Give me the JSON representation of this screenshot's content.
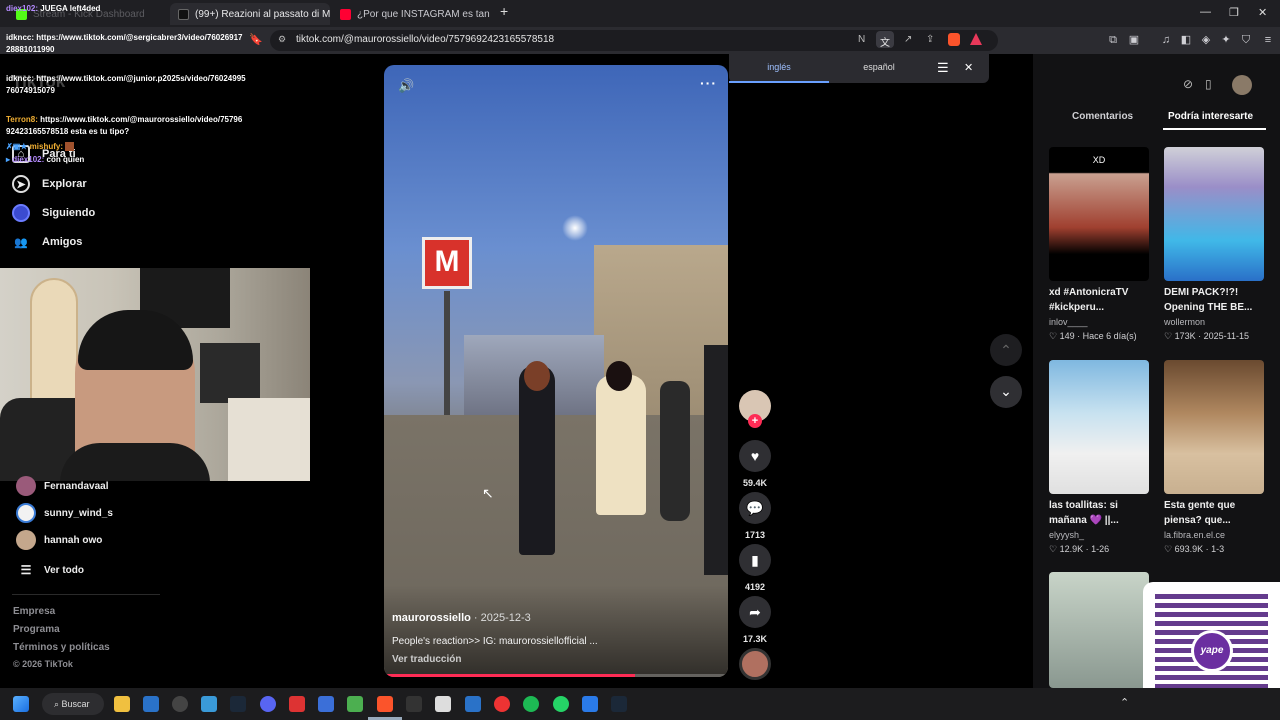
{
  "browser": {
    "tabs": [
      {
        "label": "Stream - Kick Dashboard"
      },
      {
        "label": "(99+) Reazioni al passato di M"
      },
      {
        "label": "¿Por que INSTAGRAM es tan RACISTA"
      }
    ],
    "url": "tiktok.com/@maurorossiello/video/7579692423165578518",
    "translate": {
      "source": "inglés",
      "target": "español"
    }
  },
  "chat": [
    {
      "user": "diex102:",
      "text": "JUEGA left4ded",
      "color": "#b58cff"
    },
    {
      "user": "idkncc:",
      "text": "https://www.tiktok.com/@sergicabrer3/video/7602691728881011990",
      "color": "#ffffff"
    },
    {
      "user": "idkncc:",
      "text": "https://www.tiktok.com/@junior.p2025s/video/7602499576074915079",
      "color": "#ffffff"
    },
    {
      "user": "Terron8:",
      "text": "https://www.tiktok.com/@maurorossiello/video/7579692423165578518 esta es tu tipo?",
      "color": "#f2b033"
    },
    {
      "user": "mishufy:",
      "text": "",
      "color": "#f2b033"
    },
    {
      "user": "diex102:",
      "text": "con quien",
      "color": "#b58cff"
    }
  ],
  "nav": {
    "items": [
      {
        "label": "Para ti",
        "icon": "home-icon"
      },
      {
        "label": "Explorar",
        "icon": "compass-icon"
      },
      {
        "label": "Siguiendo",
        "icon": "following-icon"
      },
      {
        "label": "Amigos",
        "icon": "friends-icon"
      }
    ],
    "following": [
      {
        "name": "Fernandavaal"
      },
      {
        "name": "sunny_wind_s"
      },
      {
        "name": "hannah owo"
      }
    ],
    "see_all": "Ver todo",
    "footer": [
      "Empresa",
      "Programa",
      "Términos y políticas",
      "© 2026 TikTok"
    ]
  },
  "video": {
    "author": "maurorossiello",
    "date": "· 2025-12-3",
    "caption": "People's reaction>> IG: maurorossiellofficial ...",
    "translate_link": "Ver traducción",
    "progress": 0.73,
    "metro_sign": "M"
  },
  "actions": {
    "likes": "59.4K",
    "comments": "1713",
    "saves": "4192",
    "shares": "17.3K"
  },
  "right_panel": {
    "tabs": [
      "Comentarios",
      "Podría interesarte"
    ],
    "cards": [
      {
        "title": "xd #AntonicraTV #kickperu...",
        "author": "inlov____",
        "likes": "149",
        "date": "· Hace 6 día(s)",
        "overlay": "XD"
      },
      {
        "title": "DEMI PACK?!?! Opening THE BE...",
        "author": "wollermon",
        "likes": "173K",
        "date": "· 2025-11-15",
        "overlay": ""
      },
      {
        "title": "las toallitas: si mañana 💜 ||...",
        "author": "elyyysh_",
        "likes": "12.9K",
        "date": "· 1-26",
        "overlay": ""
      },
      {
        "title": "Esta gente que piensa? que...",
        "author": "la.fibra.en.el.ce",
        "likes": "693.9K",
        "date": "· 1-3",
        "overlay": ""
      }
    ]
  },
  "taskbar": {
    "search": "Buscar"
  },
  "qr": {
    "brand": "yape"
  },
  "colors": {
    "accent": "#fe2c55",
    "panel": "#121214"
  }
}
